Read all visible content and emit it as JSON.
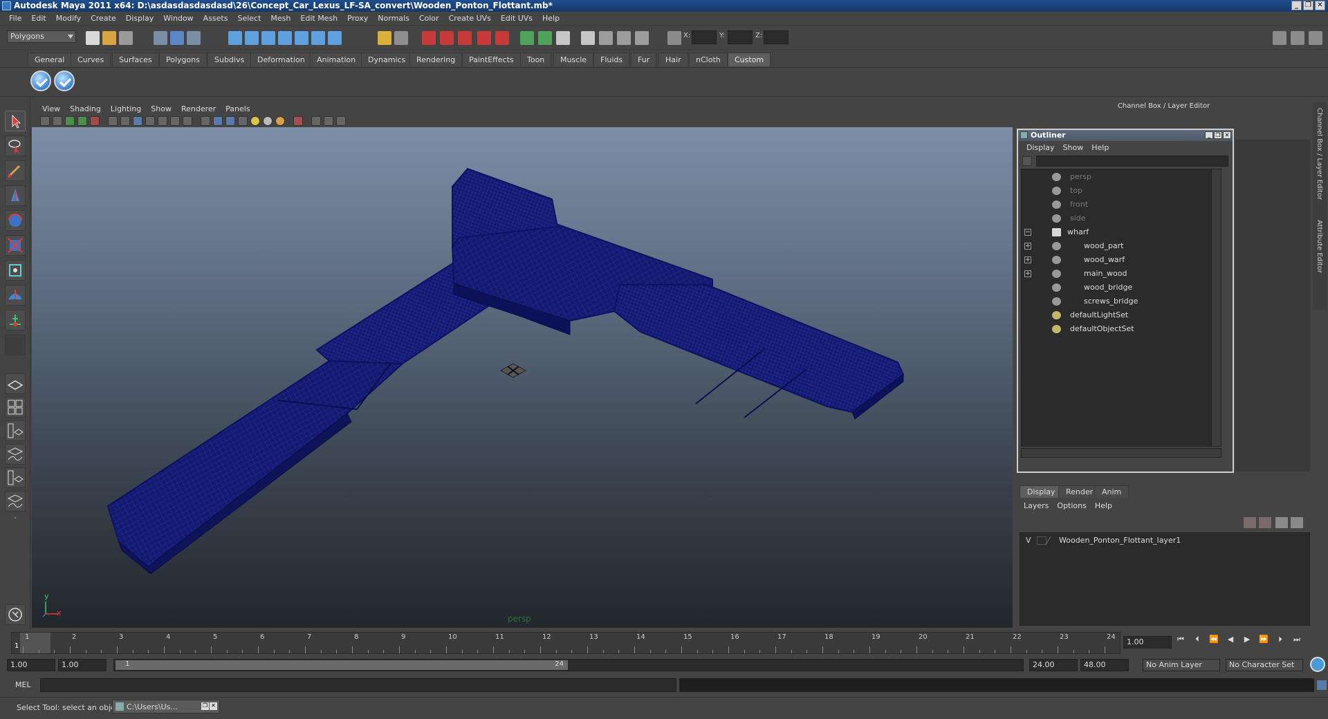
{
  "window": {
    "title": "Autodesk Maya 2011 x64: D:\\asdasdasdasdasd\\26\\Concept_Car_Lexus_LF-SA_convert\\Wooden_Ponton_Flottant.mb*",
    "controls": [
      "_",
      "❐",
      "✕"
    ]
  },
  "menubar": [
    "File",
    "Edit",
    "Modify",
    "Create",
    "Display",
    "Window",
    "Assets",
    "Select",
    "Mesh",
    "Edit Mesh",
    "Proxy",
    "Normals",
    "Color",
    "Create UVs",
    "Edit UVs",
    "Help"
  ],
  "statusline": {
    "mode": "Polygons",
    "x_label": "X:",
    "y_label": "Y:",
    "z_label": "Z:"
  },
  "shelf": {
    "tabs": [
      "General",
      "Curves",
      "Surfaces",
      "Polygons",
      "Subdivs",
      "Deformation",
      "Animation",
      "Dynamics",
      "Rendering",
      "PaintEffects",
      "Toon",
      "Muscle",
      "Fluids",
      "Fur",
      "Hair",
      "nCloth",
      "Custom"
    ],
    "active_tab": "Custom"
  },
  "viewport": {
    "menu": [
      "View",
      "Shading",
      "Lighting",
      "Show",
      "Renderer",
      "Panels"
    ],
    "camera_label": "persp",
    "axis_y": "y",
    "axis_x": "x",
    "wire_color": "#1a1f8a"
  },
  "right_panel": {
    "header": "Channel Box / Layer Editor",
    "side_tabs": [
      "Channel Box / Layer Editor",
      "Attribute Editor"
    ]
  },
  "outliner": {
    "title": "Outliner",
    "menu": [
      "Display",
      "Show",
      "Help"
    ],
    "items": [
      {
        "label": "persp",
        "dim": true,
        "indent": 0,
        "expand": ""
      },
      {
        "label": "top",
        "dim": true,
        "indent": 0,
        "expand": ""
      },
      {
        "label": "front",
        "dim": true,
        "indent": 0,
        "expand": ""
      },
      {
        "label": "side",
        "dim": true,
        "indent": 0,
        "expand": ""
      },
      {
        "label": "wharf",
        "dim": false,
        "indent": 0,
        "expand": "−"
      },
      {
        "label": "wood_part",
        "dim": false,
        "indent": 1,
        "expand": "+"
      },
      {
        "label": "wood_warf",
        "dim": false,
        "indent": 1,
        "expand": "+"
      },
      {
        "label": "main_wood",
        "dim": false,
        "indent": 1,
        "expand": "+"
      },
      {
        "label": "wood_bridge",
        "dim": false,
        "indent": 1,
        "expand": ""
      },
      {
        "label": "screws_bridge",
        "dim": false,
        "indent": 1,
        "expand": ""
      },
      {
        "label": "defaultLightSet",
        "dim": false,
        "indent": 0,
        "expand": ""
      },
      {
        "label": "defaultObjectSet",
        "dim": false,
        "indent": 0,
        "expand": ""
      }
    ]
  },
  "layer_editor": {
    "tabs": [
      "Display",
      "Render",
      "Anim"
    ],
    "menu": [
      "Layers",
      "Options",
      "Help"
    ],
    "layer_visibility": "V",
    "layer_name": "Wooden_Ponton_Flottant_layer1"
  },
  "timeline": {
    "ticks": [
      "1",
      "2",
      "3",
      "4",
      "5",
      "6",
      "7",
      "8",
      "9",
      "10",
      "11",
      "12",
      "13",
      "14",
      "15",
      "16",
      "17",
      "18",
      "19",
      "20",
      "21",
      "22",
      "23",
      "24"
    ],
    "current_frame_marker": "1",
    "current_frame": "1.00"
  },
  "range": {
    "start": "1.00",
    "playback_start": "1.00",
    "slider_start": "1",
    "slider_end": "24",
    "playback_end": "24.00",
    "end": "48.00",
    "anim_layer": "No Anim Layer",
    "character_set": "No Character Set"
  },
  "cmdline": {
    "label": "MEL"
  },
  "helpline": {
    "text": "Select Tool: select an object",
    "task": "C:\\Users\\Us..."
  }
}
